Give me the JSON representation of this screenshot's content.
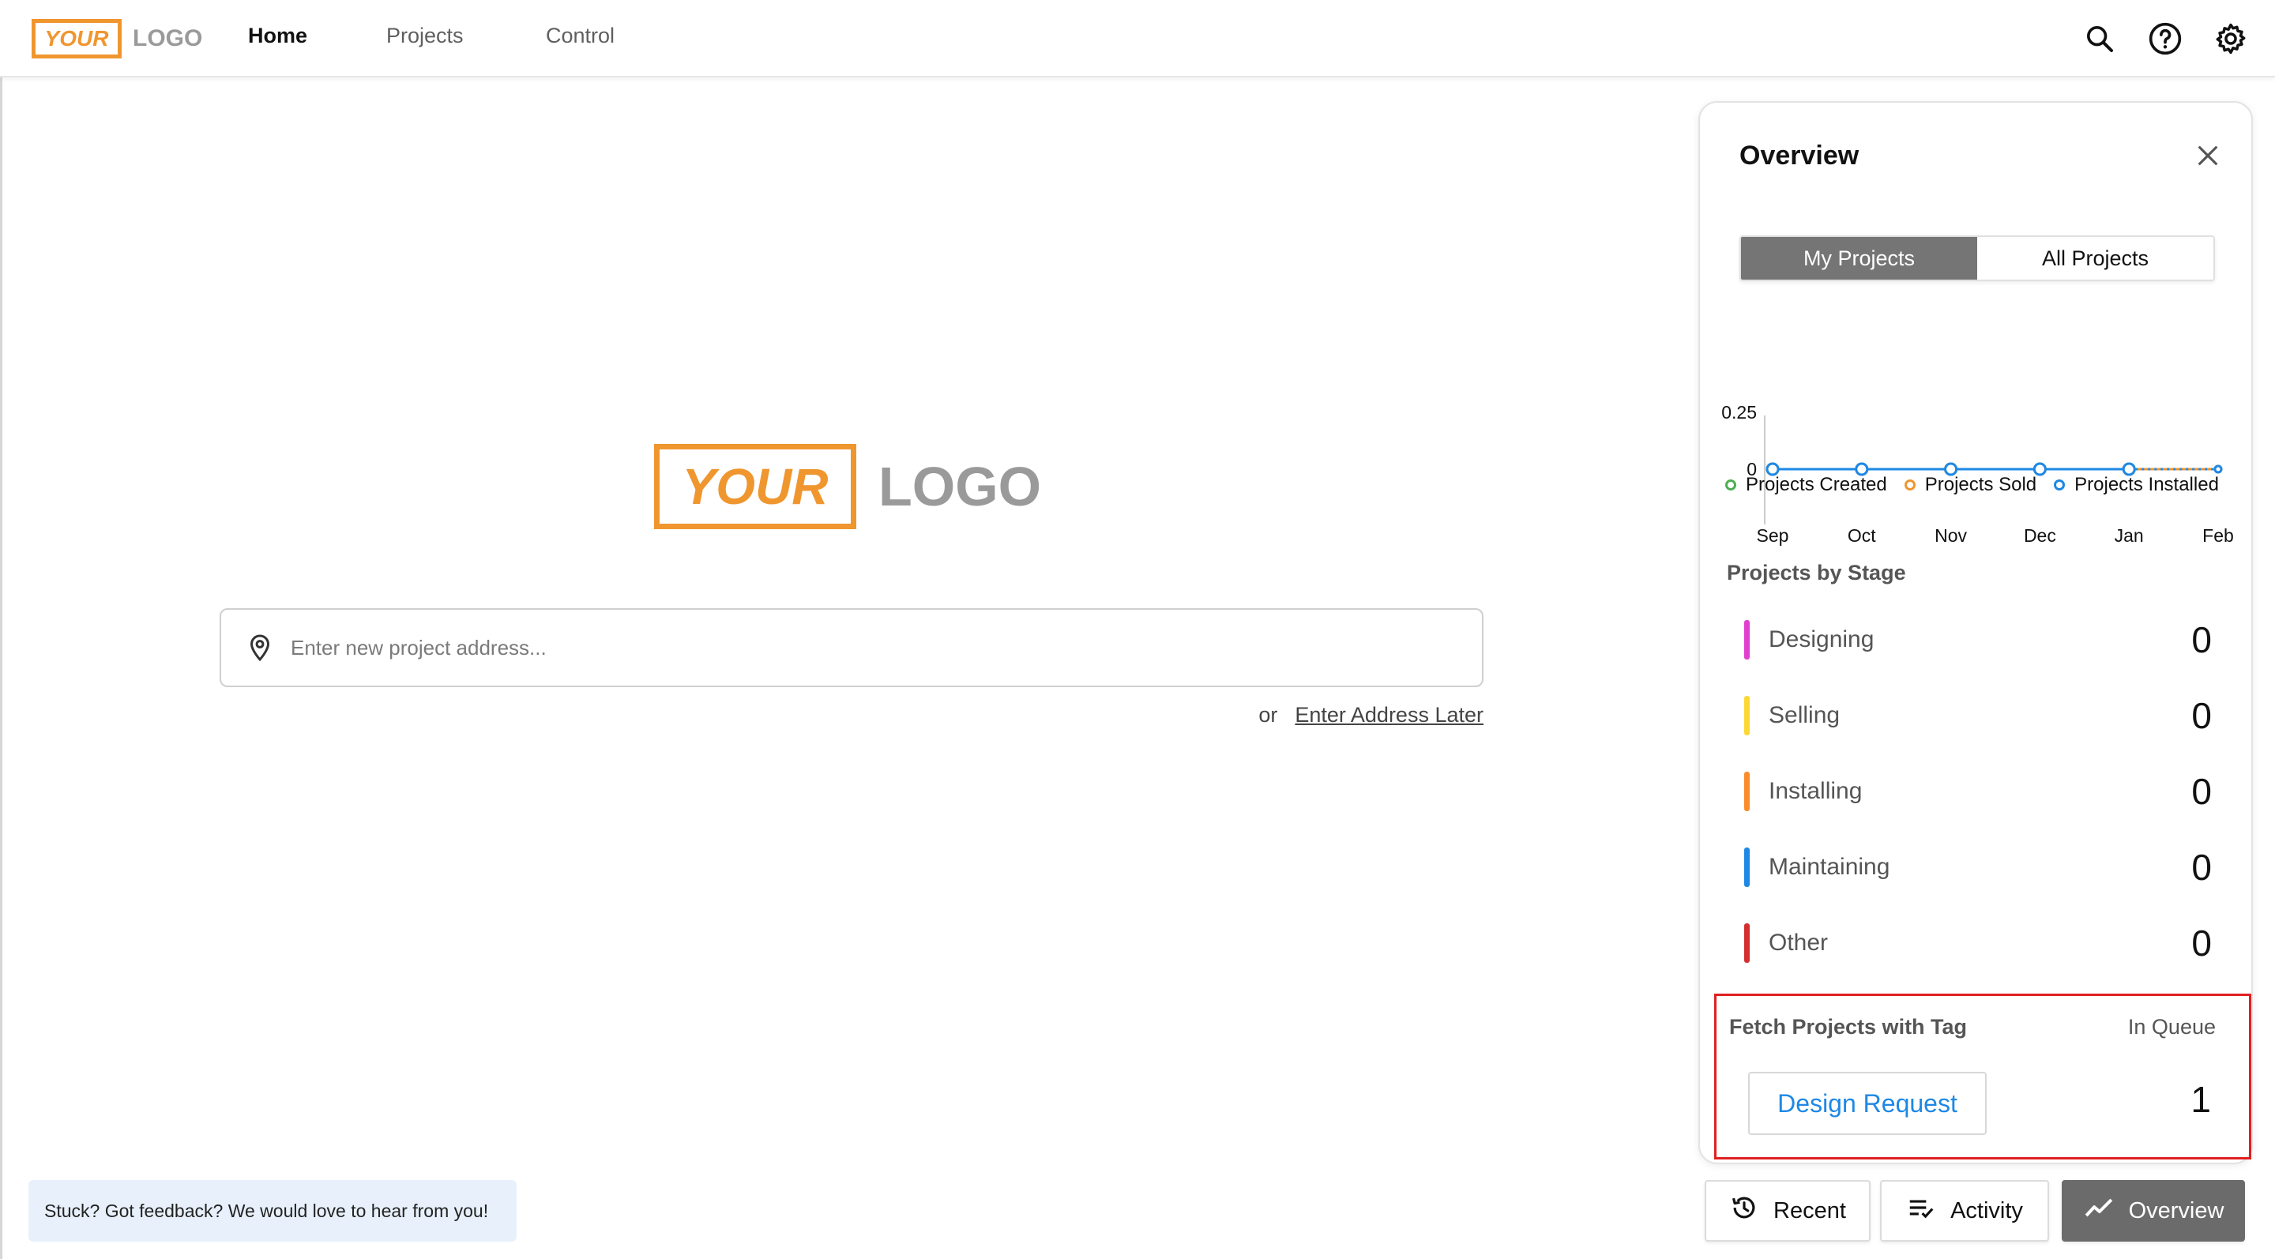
{
  "header": {
    "logo": {
      "your": "YOUR",
      "logo": "LOGO"
    },
    "nav": [
      {
        "label": "Home",
        "active": true
      },
      {
        "label": "Projects",
        "active": false
      },
      {
        "label": "Control",
        "active": false
      }
    ],
    "icons": [
      "search-icon",
      "help-icon",
      "gear-icon"
    ]
  },
  "main": {
    "logo": {
      "your": "YOUR",
      "logo": "LOGO"
    },
    "address_placeholder": "Enter new project address...",
    "or_text": "or",
    "later_link": "Enter Address Later",
    "feedback": "Stuck? Got feedback? We would love to hear from you!"
  },
  "overview": {
    "title": "Overview",
    "segments": [
      {
        "label": "My Projects",
        "active": true
      },
      {
        "label": "All Projects",
        "active": false
      }
    ],
    "legend": [
      {
        "label": "Projects Created",
        "color": "#4caf50"
      },
      {
        "label": "Projects Sold",
        "color": "#f0962f"
      },
      {
        "label": "Projects Installed",
        "color": "#1e88e5"
      }
    ],
    "stages_title": "Projects by Stage",
    "stages": [
      {
        "name": "Designing",
        "count": "0",
        "color": "#e040d0"
      },
      {
        "name": "Selling",
        "count": "0",
        "color": "#fdd835"
      },
      {
        "name": "Installing",
        "count": "0",
        "color": "#fb8c2c"
      },
      {
        "name": "Maintaining",
        "count": "0",
        "color": "#1e88e5"
      },
      {
        "name": "Other",
        "count": "0",
        "color": "#d32f2f"
      }
    ],
    "tag": {
      "title": "Fetch Projects with Tag",
      "queue_label": "In Queue",
      "button": "Design Request",
      "count": "1"
    }
  },
  "chart_data": {
    "type": "line",
    "categories": [
      "Sep",
      "Oct",
      "Nov",
      "Dec",
      "Jan",
      "Feb"
    ],
    "yticks": [
      "0.25",
      "0"
    ],
    "ylim": [
      0,
      0.25
    ],
    "series": [
      {
        "name": "Projects Created",
        "values": [
          0,
          0,
          0,
          0,
          0,
          0
        ],
        "color": "#4caf50"
      },
      {
        "name": "Projects Sold",
        "values": [
          0,
          0,
          0,
          0,
          0,
          0
        ],
        "color": "#f0962f"
      },
      {
        "name": "Projects Installed",
        "values": [
          0,
          0,
          0,
          0,
          0,
          0
        ],
        "color": "#1e88e5",
        "last_segment_dotted": true
      }
    ],
    "legend_position": "bottom"
  },
  "bottom_tabs": [
    {
      "label": "Recent",
      "icon": "history-icon",
      "active": false
    },
    {
      "label": "Activity",
      "icon": "checklist-icon",
      "active": false
    },
    {
      "label": "Overview",
      "icon": "trend-icon",
      "active": true
    }
  ]
}
